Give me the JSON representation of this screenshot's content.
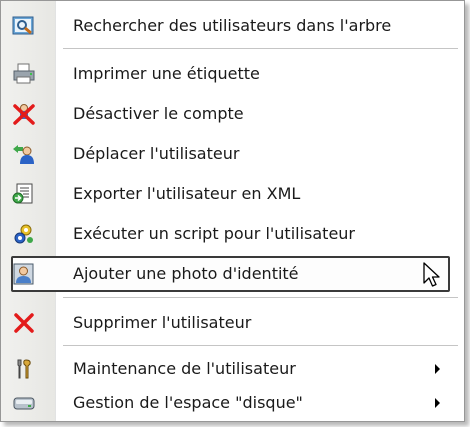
{
  "menu": {
    "items": [
      {
        "label": "Rechercher des utilisateurs dans l'arbre",
        "icon": "search-tree-icon"
      },
      {
        "label": "Imprimer une étiquette",
        "icon": "printer-icon"
      },
      {
        "label": "Désactiver le compte",
        "icon": "disable-account-icon"
      },
      {
        "label": "Déplacer l'utilisateur",
        "icon": "move-user-icon"
      },
      {
        "label": "Exporter l'utilisateur en XML",
        "icon": "export-xml-icon"
      },
      {
        "label": "Exécuter un script pour l'utilisateur",
        "icon": "run-script-icon"
      },
      {
        "label": "Ajouter une photo d'identité",
        "icon": "id-photo-icon",
        "highlighted": true
      },
      {
        "label": "Supprimer l'utilisateur",
        "icon": "delete-icon"
      },
      {
        "label": "Maintenance de l'utilisateur",
        "icon": "maintenance-tools-icon",
        "submenu": true
      },
      {
        "label": "Gestion de l'espace \"disque\"",
        "icon": "disk-icon",
        "submenu": true
      }
    ]
  },
  "colors": {
    "highlight_border": "#3a3a3a",
    "red": "#e31b1b",
    "blue": "#2b63c6"
  }
}
